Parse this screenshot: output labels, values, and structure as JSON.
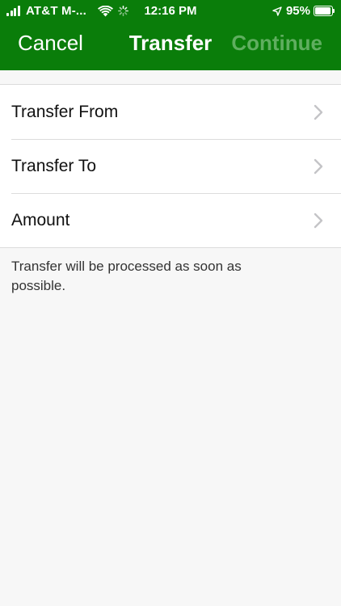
{
  "status_bar": {
    "carrier": "AT&T M-...",
    "time": "12:16 PM",
    "battery_text": "95%",
    "battery_level": 0.95
  },
  "nav": {
    "cancel_label": "Cancel",
    "title": "Transfer",
    "continue_label": "Continue"
  },
  "form": {
    "rows": [
      {
        "label": "Transfer From"
      },
      {
        "label": "Transfer To"
      },
      {
        "label": "Amount"
      }
    ]
  },
  "note": "Transfer will be processed as soon as possible.",
  "colors": {
    "header_bg": "#0a7d0a",
    "continue_disabled": "#5fae5f",
    "page_bg": "#f7f7f7",
    "chevron": "#c4c4c7"
  }
}
